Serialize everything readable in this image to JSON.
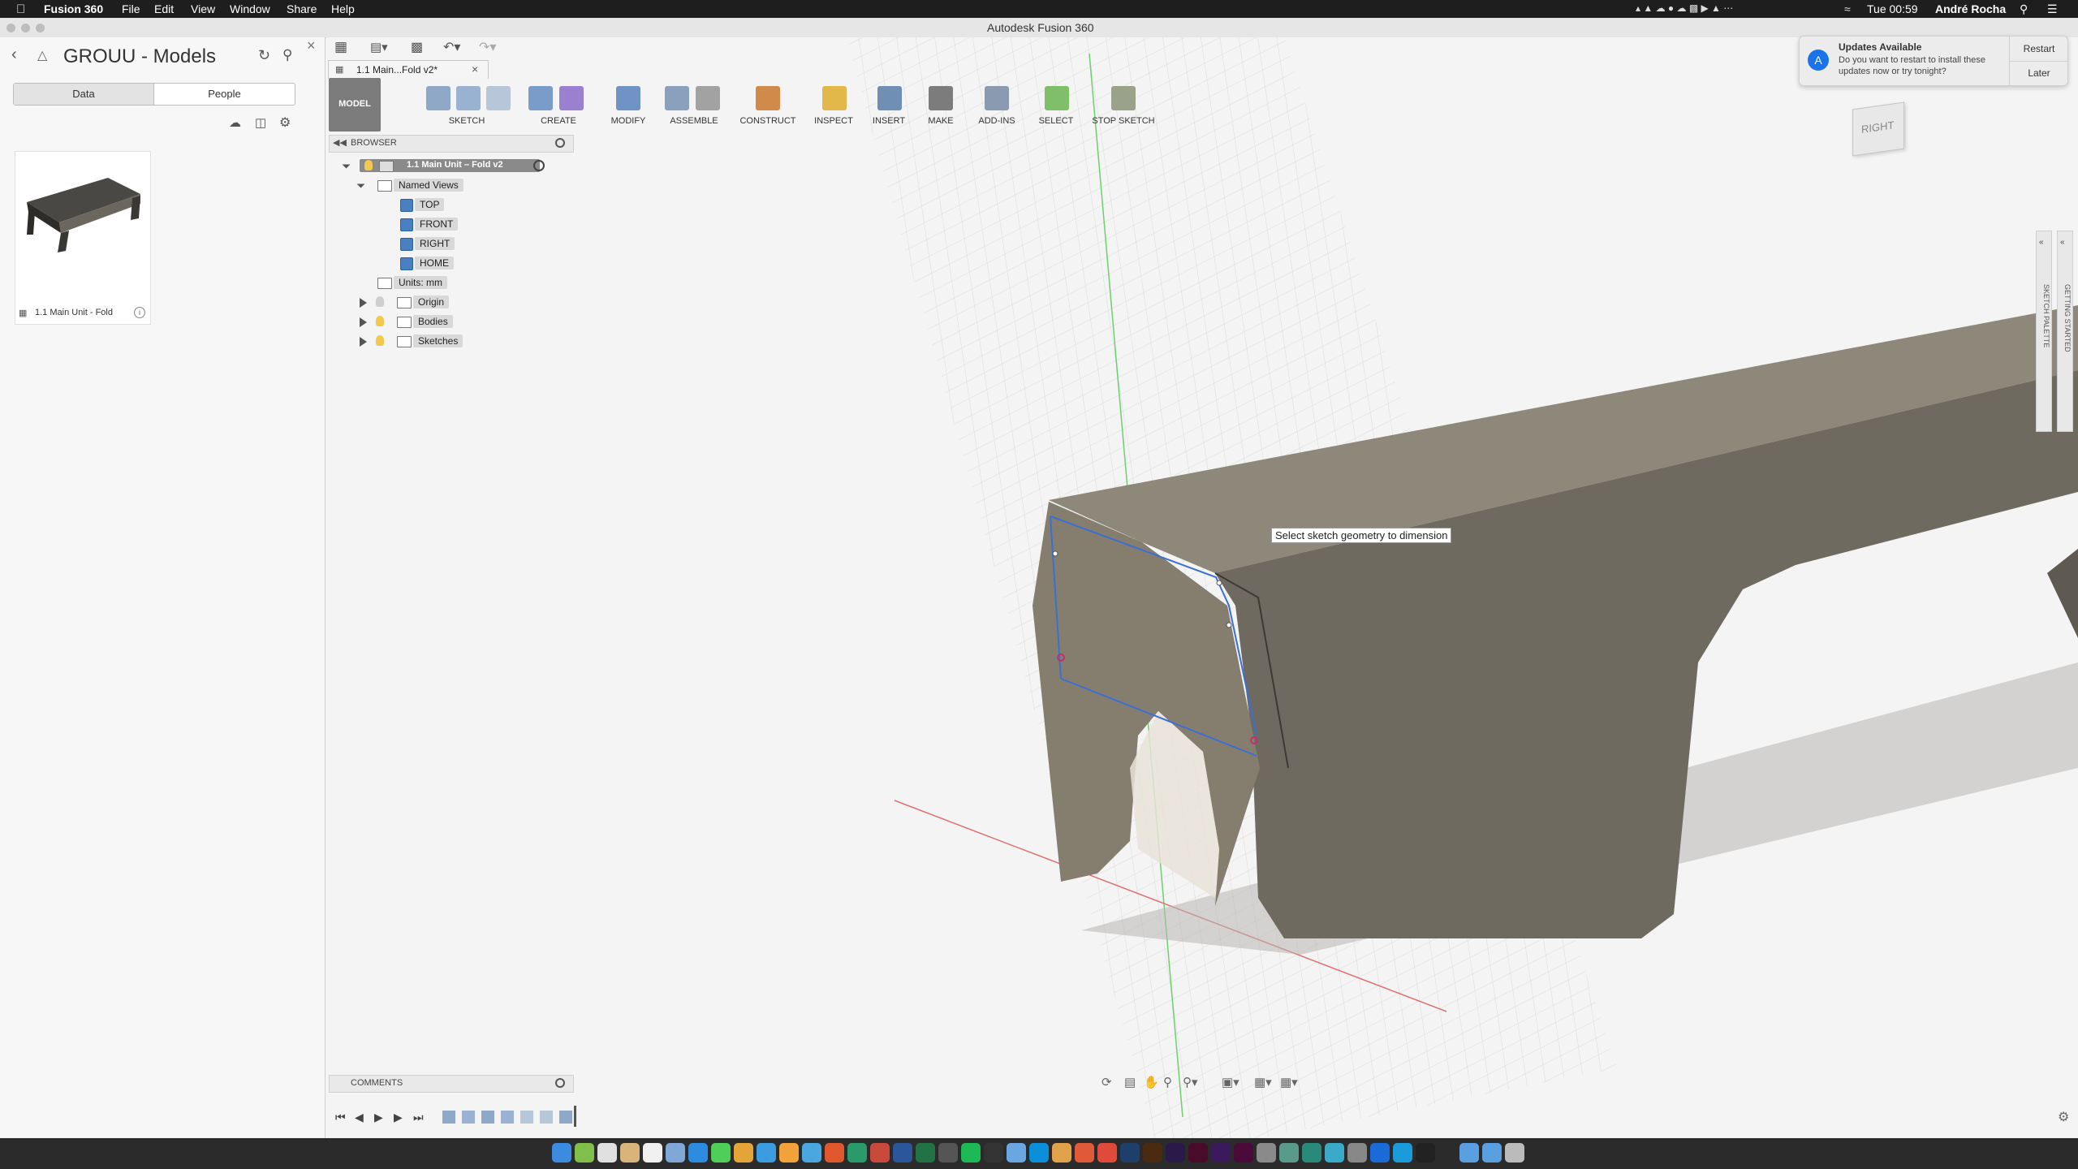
{
  "menubar": {
    "app_name": "Fusion 360",
    "menus": [
      "File",
      "Edit",
      "View",
      "Window",
      "Share",
      "Help"
    ],
    "clock": "Tue 00:59",
    "user": "André Rocha"
  },
  "window": {
    "title": "Autodesk Fusion 360"
  },
  "data_panel": {
    "project_title": "GROUU - Models",
    "tabs": [
      "Data",
      "People"
    ],
    "items": [
      {
        "name": "1.1 Main Unit - Fold"
      }
    ]
  },
  "document_tab": {
    "title": "1.1 Main...Fold v2*"
  },
  "toolbar": {
    "workspace": "MODEL",
    "groups": [
      "SKETCH",
      "CREATE",
      "MODIFY",
      "ASSEMBLE",
      "CONSTRUCT",
      "INSPECT",
      "INSERT",
      "MAKE",
      "ADD-INS",
      "SELECT",
      "STOP SKETCH"
    ]
  },
  "browser": {
    "header": "BROWSER",
    "root": "1.1 Main Unit – Fold v2",
    "named_views_label": "Named Views",
    "named_views": [
      "TOP",
      "FRONT",
      "RIGHT",
      "HOME"
    ],
    "units": "Units: mm",
    "folders": [
      "Origin",
      "Bodies",
      "Sketches"
    ]
  },
  "viewport": {
    "tooltip": "Select sketch geometry to dimension",
    "view_cube_label": "RIGHT"
  },
  "side_panels": {
    "sketch_palette": "SKETCH PALETTE",
    "getting_started": "GETTING STARTED"
  },
  "comments": {
    "label": "COMMENTS"
  },
  "notification": {
    "title": "Updates Available",
    "body": "Do you want to restart to install these updates now or try tonight?",
    "restart_label": "Restart",
    "later_label": "Later"
  },
  "colors": {
    "menubar_bg": "#1e1e1e",
    "model_body": "#6f6a5f",
    "sketch_line": "#3b6fd4",
    "accent_blue": "#1a73e8"
  }
}
